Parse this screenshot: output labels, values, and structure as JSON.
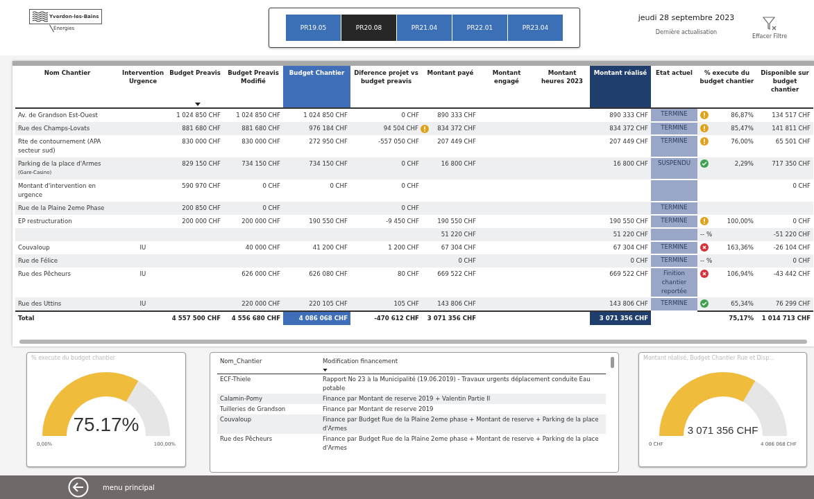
{
  "logo": {
    "name": "Yverdon-les-Bains",
    "subtitle": "Énergies"
  },
  "slicer": [
    {
      "label": "PR19.05",
      "selected": false
    },
    {
      "label": "PR20.08",
      "selected": true
    },
    {
      "label": "PR21.04",
      "selected": false
    },
    {
      "label": "PR22.01",
      "selected": false
    },
    {
      "label": "PR23.04",
      "selected": false
    }
  ],
  "date": "jeudi 28 septembre 2023",
  "date_caption": "Dernière actualisation",
  "clear_filter": {
    "label": "Effacer Filtre"
  },
  "table": {
    "columns": [
      {
        "label": "Nom Chantier",
        "kind": "text",
        "sorted": false
      },
      {
        "label": "Intervention Urgence",
        "kind": "code",
        "sorted": false
      },
      {
        "label": "Budget Preavis",
        "kind": "money",
        "sorted": true
      },
      {
        "label": "Budget Preavis Modifié",
        "kind": "money",
        "sorted": false
      },
      {
        "label": "Budget Chantier",
        "kind": "money",
        "sorted": false,
        "color": "#3f6fb8"
      },
      {
        "label": "Diference projet vs budget preavis",
        "kind": "money",
        "sorted": false
      },
      {
        "label": "Montant payé",
        "kind": "money",
        "sorted": false
      },
      {
        "label": "Montant engagé",
        "kind": "money",
        "sorted": false
      },
      {
        "label": "Montant heures 2023",
        "kind": "money",
        "sorted": false
      },
      {
        "label": "Montant réalisé",
        "kind": "money",
        "sorted": false,
        "color": "#1f3e6e"
      },
      {
        "label": "Etat actuel",
        "kind": "status",
        "sorted": false
      },
      {
        "label": "% execute du budget chantier",
        "kind": "percent",
        "sorted": false
      },
      {
        "label": "Disponible sur budget chantier",
        "kind": "money",
        "sorted": false
      }
    ],
    "rows": [
      {
        "cells": [
          "Av. de Grandson Est-Ouest",
          null,
          "1 024 850 CHF",
          "1 024 850 CHF",
          "1 024 850 CHF",
          "0 CHF",
          "890 333 CHF",
          null,
          null,
          "890 333 CHF",
          "TERMINE",
          "86,87%",
          "134 517 CHF"
        ],
        "kind": "warning"
      },
      {
        "cells": [
          "Rue des Champs-Lovats",
          null,
          "881 680 CHF",
          "881 680 CHF",
          "976 184 CHF",
          "94 504 CHF",
          "834 372 CHF",
          null,
          null,
          "834 372 CHF",
          "TERMINE",
          "85,47%",
          "141 811 CHF"
        ],
        "diff_warning": true,
        "kind": "warning"
      },
      {
        "cells": [
          "Rte de contournement (APA secteur sud)",
          null,
          "830 000 CHF",
          "830 000 CHF",
          "272 950 CHF",
          "-557 050 CHF",
          "207 449 CHF",
          null,
          null,
          "207 449 CHF",
          "TERMINE",
          "76,00%",
          "65 501 CHF"
        ],
        "kind": "warning"
      },
      {
        "cells": [
          "Parking de la place d'Armes",
          null,
          "829 150 CHF",
          "734 150 CHF",
          "734 150 CHF",
          "0 CHF",
          "16 800 CHF",
          null,
          null,
          "16 800 CHF",
          "SUSPENDU",
          "2,29%",
          "717 350 CHF"
        ],
        "note": "(Gare-Casino)",
        "kind": "ok"
      },
      {
        "cells": [
          "Montant d'intervention en urgence",
          null,
          "590 970 CHF",
          "0 CHF",
          "0 CHF",
          "0 CHF",
          null,
          null,
          null,
          null,
          null,
          null,
          "0 CHF"
        ]
      },
      {
        "cells": [
          "Rue de la Plaine 2eme Phase",
          null,
          "200 850 CHF",
          "0 CHF",
          null,
          "0 CHF",
          null,
          null,
          null,
          null,
          "TERMINE",
          null,
          null
        ]
      },
      {
        "cells": [
          "EP restructuration",
          null,
          "200 000 CHF",
          "200 000 CHF",
          "190 550 CHF",
          "-9 450 CHF",
          "190 550 CHF",
          null,
          null,
          "190 550 CHF",
          "TERMINE",
          "100,00%",
          "0 CHF"
        ],
        "kind": "warning"
      },
      {
        "cells": [
          null,
          null,
          null,
          null,
          null,
          null,
          "51 220 CHF",
          null,
          null,
          "51 220 CHF",
          null,
          "-- %",
          "-51 220 CHF"
        ]
      },
      {
        "cells": [
          "Couvaloup",
          "IU",
          null,
          "40 000 CHF",
          "41 200 CHF",
          "1 200 CHF",
          "67 304 CHF",
          null,
          null,
          "67 304 CHF",
          "TERMINE",
          "163,36%",
          "-26 104 CHF"
        ],
        "kind": "error"
      },
      {
        "cells": [
          "Rue de Félice",
          null,
          null,
          null,
          null,
          null,
          "0 CHF",
          null,
          null,
          "0 CHF",
          "TERMINE",
          "-- %",
          "0 CHF"
        ]
      },
      {
        "cells": [
          "Rue des Pêcheurs",
          "IU",
          null,
          "626 000 CHF",
          "626 080 CHF",
          "80 CHF",
          "669 522 CHF",
          null,
          null,
          "669 522 CHF",
          "Finition chantier reportée",
          "106,94%",
          "-43 442 CHF"
        ],
        "kind": "error"
      },
      {
        "cells": [
          "Rue des Uttins",
          "IU",
          null,
          "220 000 CHF",
          "220 105 CHF",
          "105 CHF",
          "143 806 CHF",
          null,
          null,
          "143 806 CHF",
          "TERMINE",
          "65,34%",
          "76 299 CHF"
        ],
        "kind": "ok"
      },
      {
        "cells": [
          "Total",
          null,
          "4 557 500 CHF",
          "4 556 680 CHF",
          "4 086 068 CHF",
          "-470 612 CHF",
          "3 071 356 CHF",
          null,
          null,
          "3 071 356 CHF",
          null,
          "75,17%",
          "1 014 713 CHF"
        ],
        "kind": "total"
      }
    ]
  },
  "gauges": [
    {
      "title": "% execute du budget chantier",
      "value": "75.17%",
      "min": "0,00%",
      "max": "100,00%",
      "level": 0.7517
    },
    {
      "title": "Montant réalisé, Budget Chantier Rue et Disp...",
      "value": "3 071 356 CHF",
      "min": "0 CHF",
      "max": "4 086 068 CHF",
      "level": 0.7517
    }
  ],
  "funding": {
    "columns": [
      {
        "label": "Nom_Chantier",
        "sorted": false
      },
      {
        "label": "Modification financement",
        "sorted": true
      }
    ],
    "rows": [
      [
        "ECF-Thiele",
        "Rapport No 23 à la Municipalité (19.06.2019) - Travaux urgents déplacement conduite Eau potable"
      ],
      [
        "Calamin-Pomy",
        "Finance par Montant de reserve 2019 + Valentin Partie II"
      ],
      [
        "Tuilleries de Grandson",
        "Finance par Montant de reserve 2019"
      ],
      [
        "Couvaloup",
        "Finance par Budget Rue de la Plaine 2eme phase + Montant de reserve + Parking de la place d'Armes"
      ],
      [
        "Rue des Pêcheurs",
        "Finance par Budget Rue de la Plaine 2eme phase + Montant de reserve + Parking de la place d'Armes"
      ]
    ]
  },
  "footer": {
    "label": "menu principal"
  }
}
